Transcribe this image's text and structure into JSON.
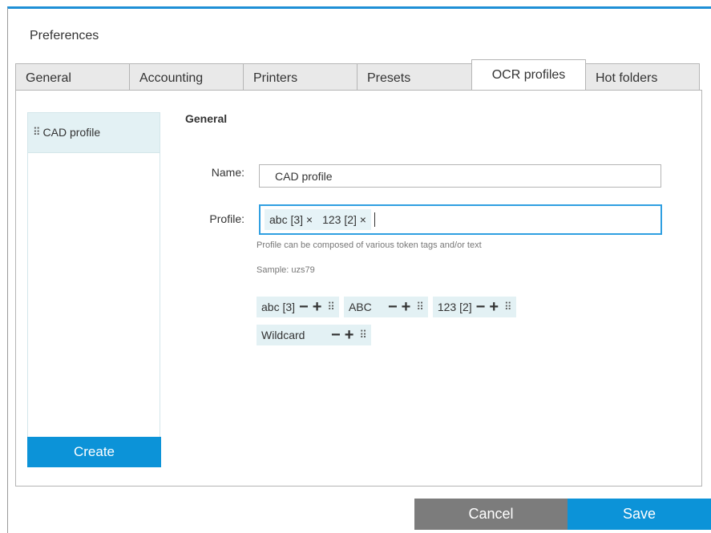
{
  "window": {
    "title": "Preferences",
    "accent": "#0c93d8"
  },
  "tabs": [
    {
      "label": "General"
    },
    {
      "label": "Accounting"
    },
    {
      "label": "Printers"
    },
    {
      "label": "Presets"
    },
    {
      "label": "OCR profiles",
      "active": true
    },
    {
      "label": "Hot folders"
    }
  ],
  "sidebar": {
    "items": [
      {
        "label": "CAD profile",
        "icon": "drag-handle-icon"
      }
    ],
    "create_label": "Create"
  },
  "form": {
    "section_title": "General",
    "name_label": "Name:",
    "name_value": "CAD profile",
    "profile_label": "Profile:",
    "profile_tags": [
      "abc [3] ×",
      "123 [2] ×"
    ],
    "hint": "Profile can be composed of various token tags and/or text",
    "sample": "Sample: uzs79"
  },
  "tokens": [
    {
      "label": "abc [3]"
    },
    {
      "label": "ABC"
    },
    {
      "label": "123 [2]"
    },
    {
      "label": "Wildcard"
    }
  ],
  "token_controls": {
    "minus": "−",
    "plus": "+",
    "grip": "⠿"
  },
  "footer": {
    "cancel_label": "Cancel",
    "save_label": "Save"
  }
}
